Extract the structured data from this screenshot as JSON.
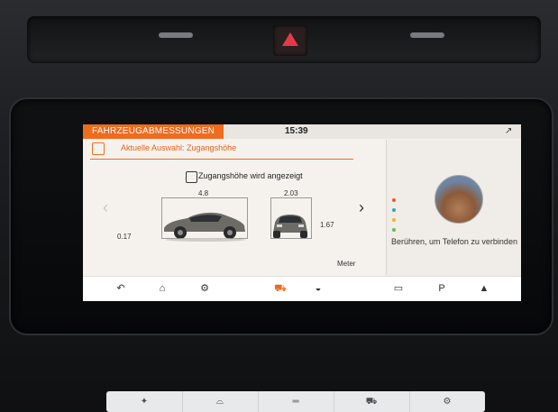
{
  "screen": {
    "title": "FAHRZEUGABMESSUNGEN",
    "time": "15:39",
    "signal_icon": "signal-icon",
    "current_selection": "Aktuelle Auswahl: Zugangshöhe",
    "access_height_text": "Zugangshöhe wird angezeigt",
    "dimensions": {
      "length": "4.8",
      "width": "2.03",
      "height": "1.67",
      "ground_clearance": "0.17"
    },
    "unit": "Meter",
    "phone_text": "Berühren, um Telefon zu verbinden",
    "page_dot_colors": [
      "#e65a2e",
      "#35a7b3",
      "#f0b323",
      "#67b95e"
    ],
    "nav": {
      "back_icon": "back-icon",
      "home_icon": "home-icon",
      "settings_icon": "settings-icon",
      "suspension_icon": "suspension-icon",
      "drive_mode_icon": "drive-mode-icon",
      "camera_icon": "camera-icon",
      "park_assist_label": "P",
      "terrain_icon": "terrain-icon"
    }
  },
  "console": {
    "climate_icon": "fan-icon",
    "seat_icon": "seat-icon",
    "dash_icon": "lines-icon",
    "car_icon": "car-icon",
    "settings_icon": "settings-icon"
  }
}
